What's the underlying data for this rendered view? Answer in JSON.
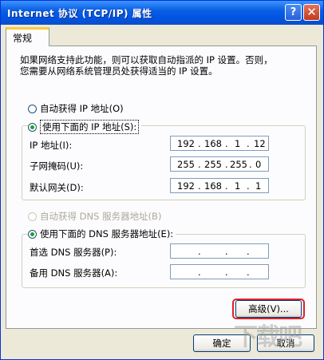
{
  "window": {
    "title": "Internet 协议 (TCP/IP) 属性",
    "help_label": "?",
    "close_label": "✕"
  },
  "tabs": [
    {
      "label": "常规"
    }
  ],
  "description": [
    "如果网络支持此功能，则可以获取自动指派的 IP 设置。否则，",
    "您需要从网络系统管理员处获得适当的 IP 设置。"
  ],
  "ip_mode": {
    "auto_label": "自动获得 IP 地址(O)",
    "manual_label": "使用下面的 IP 地址(S):",
    "selected": "manual"
  },
  "ip_fields": [
    {
      "label": "IP 地址(I):",
      "octets": [
        "192",
        "168",
        "1",
        "12"
      ]
    },
    {
      "label": "子网掩码(U):",
      "octets": [
        "255",
        "255",
        "255",
        "0"
      ]
    },
    {
      "label": "默认网关(D):",
      "octets": [
        "192",
        "168",
        "1",
        "1"
      ]
    }
  ],
  "dns_mode": {
    "auto_label": "自动获得 DNS 服务器地址(B)",
    "manual_label": "使用下面的 DNS 服务器地址(E):",
    "selected": "manual",
    "auto_disabled": true
  },
  "dns_fields": [
    {
      "label": "首选 DNS 服务器(P):",
      "octets": [
        "",
        "",
        "",
        ""
      ]
    },
    {
      "label": "备用 DNS 服务器(A):",
      "octets": [
        "",
        "",
        "",
        ""
      ]
    }
  ],
  "buttons": {
    "advanced": "高级(V)...",
    "ok": "确定",
    "cancel": "取消"
  },
  "watermark": "下载吧"
}
